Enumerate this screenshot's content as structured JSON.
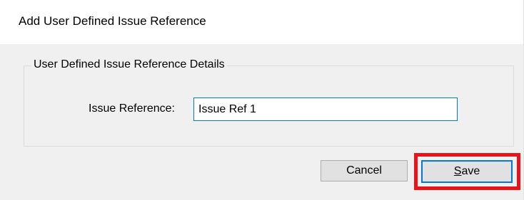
{
  "dialog": {
    "title": "Add User Defined Issue Reference",
    "group_title": "User Defined Issue Reference Details",
    "issue_reference_label": "Issue Reference:",
    "issue_reference_value": "Issue Ref 1",
    "cancel_label": "Cancel",
    "save_label_mnemonic": "S",
    "save_label_rest": "ave",
    "highlight_color": "#e8141c",
    "focus_color": "#0078d7"
  }
}
